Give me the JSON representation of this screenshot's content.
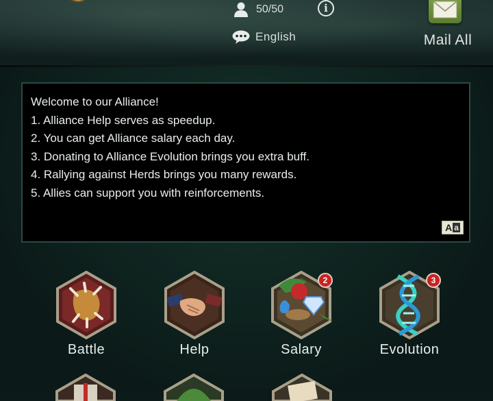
{
  "header": {
    "members": "50/50",
    "language": "English",
    "mail_all_label": "Mail All"
  },
  "announcement": {
    "lines": [
      "Welcome to our Alliance!",
      "1. Alliance Help serves as speedup.",
      "2. You can get Alliance salary each day.",
      "3. Donating to Alliance Evolution brings you extra buff.",
      "4. Rallying against Herds brings you many rewards.",
      "5. Allies can support you with reinforcements."
    ],
    "translate_glyph_1": "A",
    "translate_glyph_2": "a"
  },
  "features": [
    {
      "label": "Battle",
      "icon": "claw-icon",
      "badge": ""
    },
    {
      "label": "Help",
      "icon": "handshake-icon",
      "badge": ""
    },
    {
      "label": "Salary",
      "icon": "resources-icon",
      "badge": "2"
    },
    {
      "label": "Evolution",
      "icon": "dna-icon",
      "badge": "3"
    }
  ],
  "colors": {
    "background": "#0c1a19",
    "badge": "#c92222",
    "hex_border": "#a9a08a"
  }
}
